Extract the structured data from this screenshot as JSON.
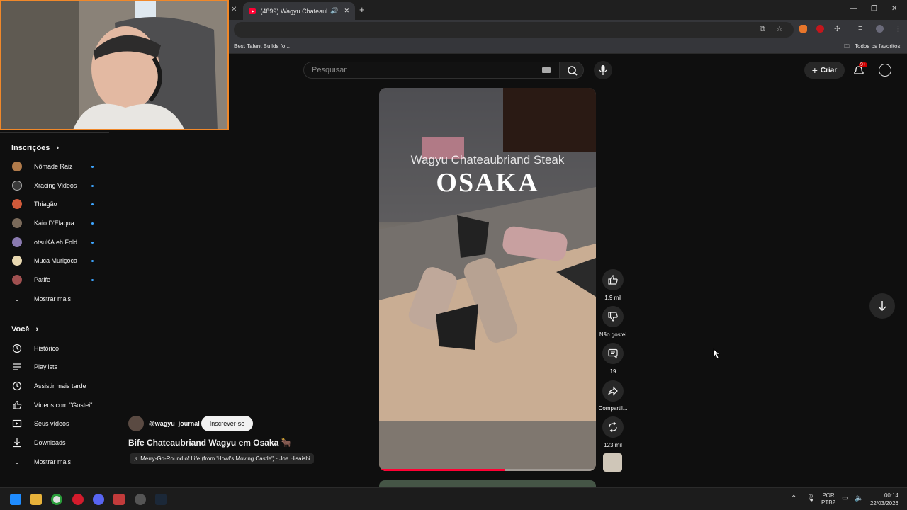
{
  "browser": {
    "active_tab_title": "(4899) Wagyu Chateaubriand",
    "bookmark_item": "Best Talent Builds fo...",
    "all_bookmarks": "Todos os favoritos"
  },
  "youtube": {
    "search_placeholder": "Pesquisar",
    "create_label": "Criar",
    "notification_count": "9+"
  },
  "sidebar": {
    "subscriptions_header": "Inscrições",
    "subscriptions": [
      {
        "label": "Nômade Raiz",
        "avatar_color": "#b07a4a"
      },
      {
        "label": "Xracing Videos",
        "avatar_color": "#3a3a3a"
      },
      {
        "label": "Thiagão",
        "avatar_color": "#d05a3a"
      },
      {
        "label": "Kaio D'Elaqua",
        "avatar_color": "#7a6a5a"
      },
      {
        "label": "otsuKA eh Fold",
        "avatar_color": "#8a7ab0"
      },
      {
        "label": "Muca Muriçoca",
        "avatar_color": "#e8d8b0"
      },
      {
        "label": "Patife",
        "avatar_color": "#a05050"
      }
    ],
    "subscriptions_more": "Mostrar mais",
    "you_header": "Você",
    "you_items": [
      {
        "label": "Histórico",
        "icon": "history-icon"
      },
      {
        "label": "Playlists",
        "icon": "playlist-icon"
      },
      {
        "label": "Assistir mais tarde",
        "icon": "clock-icon"
      },
      {
        "label": "Vídeos com \"Gostei\"",
        "icon": "thumbs-up-icon"
      },
      {
        "label": "Seus vídeos",
        "icon": "video-icon"
      },
      {
        "label": "Downloads",
        "icon": "download-icon"
      }
    ],
    "you_more": "Mostrar mais"
  },
  "short": {
    "overlay_title": "Wagyu Chateaubriand Steak",
    "overlay_city": "OSAKA",
    "channel": "@wagyu_journal",
    "subscribe_label": "Inscrever-se",
    "title": "Bife Chateaubriand Wagyu em Osaka 🐂",
    "music": "♬ Merry-Go-Round of Life (from 'Howl's Moving Castle') · Joe Hisaishi",
    "progress": 0.58,
    "likes": "1,9 mil",
    "dislike_label": "Não gostei",
    "comments": "19",
    "share_label": "Compartil...",
    "remix_count": "123 mil"
  },
  "taskbar": {
    "lang": "POR",
    "layout": "PTB2",
    "time": "00:14",
    "date": "22/03/2026"
  },
  "colors": {
    "accent_red": "#ff0033",
    "link_blue": "#3ea6ff",
    "webcam_border": "#f0882a"
  }
}
